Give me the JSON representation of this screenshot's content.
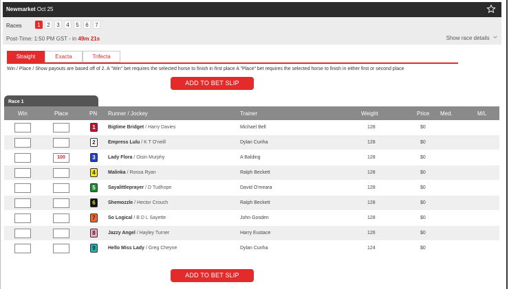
{
  "header": {
    "venue": "Newmarket",
    "date": "Oct 25"
  },
  "races": {
    "label": "Races",
    "tabs": [
      "1",
      "2",
      "3",
      "4",
      "5",
      "6",
      "7"
    ],
    "active_index": 0
  },
  "post_time": {
    "prefix": "Post-Time: 1:50 PM GST - in",
    "countdown": "49m 21s"
  },
  "show_details_label": "Show race details",
  "bet_tabs": [
    {
      "label": "Straight",
      "active": true
    },
    {
      "label": "Exacta",
      "active": false
    },
    {
      "label": "Trifecta",
      "active": false
    }
  ],
  "note": "Win / Place / Show payouts are based off of 2. A \"Win\" bet requires the selected horse to finish in first place A \"Place\" bet requires the selected horse to finish in either first or second place",
  "add_to_bet_slip_label": "ADD TO BET SLIP",
  "race_label": "Race 1",
  "columns": {
    "win": "Win",
    "place": "Place",
    "pn": "PN",
    "runner_jockey": "Runner / Jockey",
    "trainer": "Trainer",
    "weight": "Weight",
    "price": "Price",
    "med": "Med.",
    "ml": "M/L"
  },
  "runners": [
    {
      "pn": "1",
      "pn_bg": "#c8102e",
      "pn_fg": "#ffffff",
      "runner": "Bigtime Bridget",
      "jockey": "Harry Davies",
      "trainer": "Michael Bell",
      "weight": "128",
      "price": "$0",
      "win": "",
      "place": ""
    },
    {
      "pn": "2",
      "pn_bg": "#ffffff",
      "pn_fg": "#222222",
      "runner": "Empress Lulu",
      "jockey": "K T O'neill",
      "trainer": "Dylan Cunha",
      "weight": "128",
      "price": "$0",
      "win": "",
      "place": ""
    },
    {
      "pn": "3",
      "pn_bg": "#1f3fc8",
      "pn_fg": "#ffffff",
      "runner": "Lady Flora",
      "jockey": "Oisin Murphy",
      "trainer": "A Balding",
      "weight": "128",
      "price": "$0",
      "win": "",
      "place": "100"
    },
    {
      "pn": "4",
      "pn_bg": "#f2e21a",
      "pn_fg": "#222222",
      "runner": "Malinka",
      "jockey": "Rossa Ryan",
      "trainer": "Ralph Beckett",
      "weight": "128",
      "price": "$0",
      "win": "",
      "place": ""
    },
    {
      "pn": "5",
      "pn_bg": "#1e8a2e",
      "pn_fg": "#ffffff",
      "runner": "Sayalittleprayer",
      "jockey": "D Tudhope",
      "trainer": "David O'meara",
      "weight": "128",
      "price": "$0",
      "win": "",
      "place": ""
    },
    {
      "pn": "6",
      "pn_bg": "#111111",
      "pn_fg": "#f2e21a",
      "runner": "Shemozzle",
      "jockey": "Hector Crouch",
      "trainer": "Ralph Beckett",
      "weight": "128",
      "price": "$0",
      "win": "",
      "place": ""
    },
    {
      "pn": "7",
      "pn_bg": "#f26522",
      "pn_fg": "#222222",
      "runner": "So Logical",
      "jockey": "B D L Sayette",
      "trainer": "John Gosden",
      "weight": "128",
      "price": "$0",
      "win": "",
      "place": ""
    },
    {
      "pn": "8",
      "pn_bg": "#f4a7c3",
      "pn_fg": "#222222",
      "runner": "Jazzy Angel",
      "jockey": "Hayley Turner",
      "trainer": "Harry Eustace",
      "weight": "126",
      "price": "$0",
      "win": "",
      "place": ""
    },
    {
      "pn": "9",
      "pn_bg": "#1fb5b0",
      "pn_fg": "#222222",
      "runner": "Hello Miss Lady",
      "jockey": "Greg Cheyne",
      "trainer": "Dylan Cunha",
      "weight": "124",
      "price": "$0",
      "win": "",
      "place": ""
    }
  ],
  "colors": {
    "accent": "#e32b2b",
    "header_bg": "#2b2b2b",
    "table_header_bg": "#8a8a8a"
  }
}
